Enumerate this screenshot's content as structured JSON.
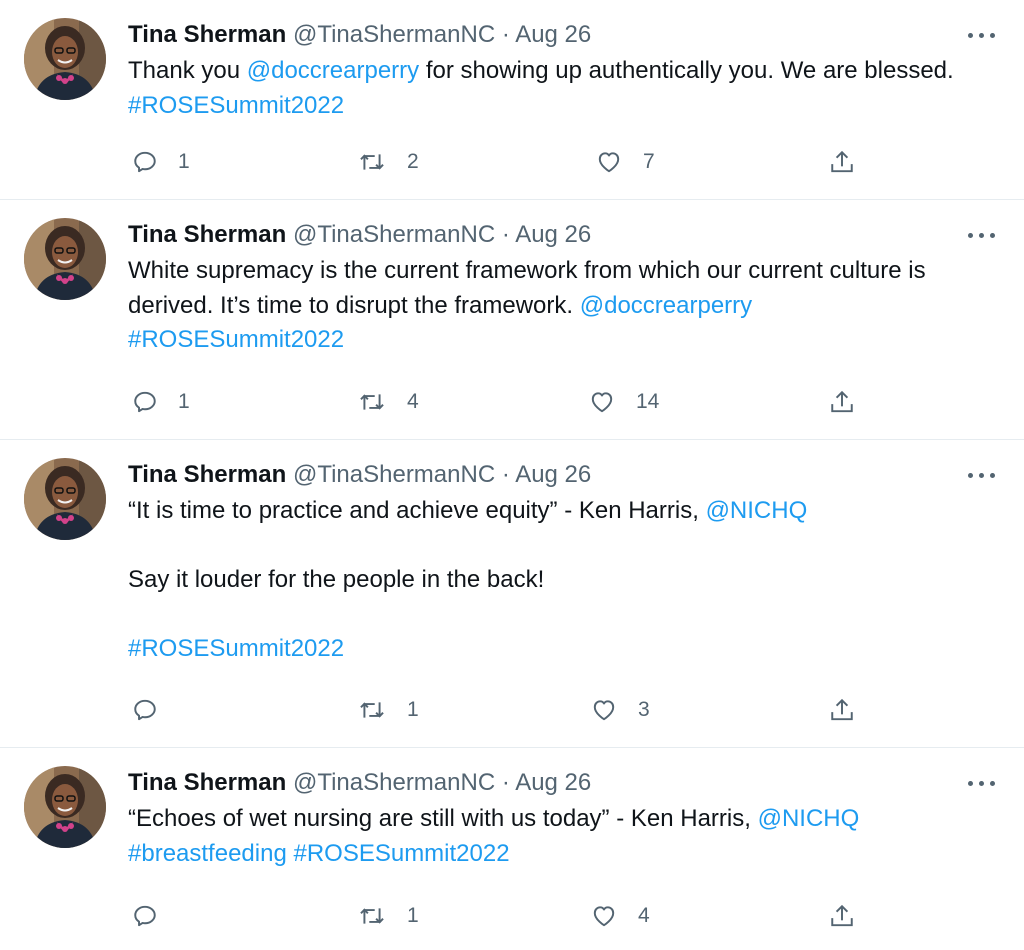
{
  "colors": {
    "link": "#1d9bf0",
    "muted": "#536471",
    "text": "#0f1419",
    "divider": "#e6ecf0"
  },
  "icons": [
    "avatar",
    "reply-icon",
    "retweet-icon",
    "like-icon",
    "share-icon",
    "more-icon"
  ],
  "tweets": [
    {
      "name": "Tina Sherman",
      "handle": "@TinaShermanNC",
      "dot": "·",
      "date": "Aug 26",
      "text": {
        "t1": "Thank you ",
        "m1": "@doccrearperry",
        "t2": " for showing up authentically you. We are blessed. ",
        "h1": "#ROSESummit2022"
      },
      "replies": "1",
      "retweets": "2",
      "likes": "7"
    },
    {
      "name": "Tina Sherman",
      "handle": "@TinaShermanNC",
      "dot": "·",
      "date": "Aug 26",
      "text": {
        "t1": "White supremacy is the current framework from which our current culture is derived. It’s time to disrupt the framework. ",
        "m1": "@doccrearperry",
        "h1": "#ROSESummit2022"
      },
      "replies": "1",
      "retweets": "4",
      "likes": "14"
    },
    {
      "name": "Tina Sherman",
      "handle": "@TinaShermanNC",
      "dot": "·",
      "date": "Aug 26",
      "text": {
        "t1": "“It is time to practice and achieve equity” - Ken Harris, ",
        "m1": "@NICHQ",
        "p2": "Say it louder for the people in the back!",
        "h1": "#ROSESummit2022"
      },
      "replies": "",
      "retweets": "1",
      "likes": "3"
    },
    {
      "name": "Tina Sherman",
      "handle": "@TinaShermanNC",
      "dot": "·",
      "date": "Aug 26",
      "text": {
        "t1": "“Echoes of wet nursing are still with us today” - Ken Harris, ",
        "m1": "@NICHQ",
        "h1": "#breastfeeding",
        "h2": "#ROSESummit2022"
      },
      "replies": "",
      "retweets": "1",
      "likes": "4"
    }
  ]
}
